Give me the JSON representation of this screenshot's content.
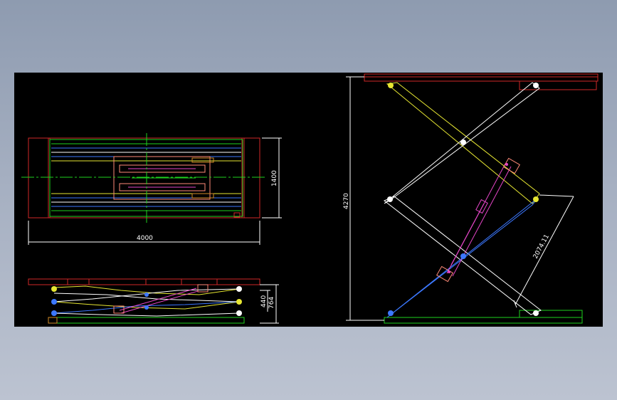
{
  "drawing": {
    "colors": {
      "background": "#000000",
      "frame_red": "#d02828",
      "green": "#1ed21e",
      "yellow": "#e6e632",
      "white": "#ffffff",
      "blue": "#3c78ff",
      "magenta": "#e646c8",
      "salmon": "#ff8a78",
      "orange": "#d28c28",
      "cyan_blue": "#5aa0ff"
    },
    "plan_view": {
      "width_label": "4000",
      "height_label": "1400"
    },
    "side_view_small": {
      "min_height_label": "440",
      "max_height_label": "764"
    },
    "side_view_large": {
      "lift_height_label": "4270",
      "cylinder_length_label": "2074.11"
    }
  }
}
